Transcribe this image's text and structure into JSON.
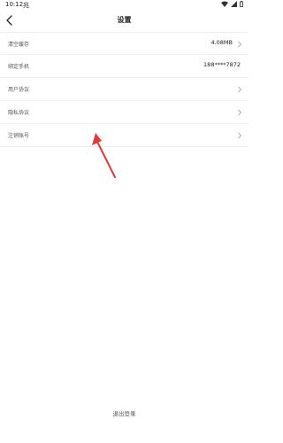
{
  "status_bar": {
    "time": "10:12",
    "notification": "兆"
  },
  "header": {
    "title": "设置"
  },
  "settings": {
    "clear_cache_label": "清空缓存",
    "cache_size": "4.08MB",
    "bind_phone_label": "绑定手机",
    "phone_number": "188****7872",
    "user_agreement_label": "用户协议",
    "privacy_policy_label": "隐私协议",
    "cancel_account_label": "注销账号"
  },
  "footer": {
    "logout_label": "退出登录"
  },
  "colors": {
    "annotation_arrow": "#e53935",
    "divider": "#eeeeee"
  }
}
